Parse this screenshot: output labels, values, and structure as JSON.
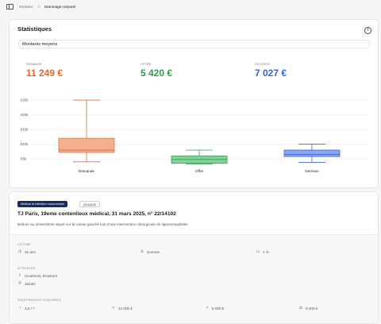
{
  "breadcrumb": {
    "section": "Modules",
    "separator": ">",
    "current": "Dommage corporel"
  },
  "stats": {
    "title": "Statistiques",
    "info_icon": "info-icon",
    "select_value": "Montants moyens",
    "kpis": [
      {
        "label": "DEMANDE",
        "value": "11 249 €",
        "color": "#e0692a"
      },
      {
        "label": "OFFRE",
        "value": "5 420 €",
        "color": "#2e9a4e"
      },
      {
        "label": "DÉCISION",
        "value": "7 027 €",
        "color": "#3563d4"
      }
    ]
  },
  "chart_data": {
    "type": "boxplot",
    "categories": [
      "Demande",
      "Offre",
      "Décision"
    ],
    "y_ticks": [
      {
        "value": 5000,
        "label": "€5k"
      },
      {
        "value": 10000,
        "label": "€10k"
      },
      {
        "value": 15000,
        "label": "€15k"
      },
      {
        "value": 20000,
        "label": "€20k"
      },
      {
        "value": 25000,
        "label": "€25k"
      }
    ],
    "ylim": [
      3000,
      26500
    ],
    "grid": true,
    "boxes": [
      {
        "name": "Demande",
        "min": 4000,
        "q1": 7200,
        "median": 8000,
        "q3": 12000,
        "max": 25000,
        "fill": "#f3b08e",
        "stroke": "#d9733e"
      },
      {
        "name": "Offre",
        "min": 3300,
        "q1": 3500,
        "median": 4800,
        "q3": 6000,
        "max": 8000,
        "fill": "#84d39a",
        "stroke": "#3c9a55"
      },
      {
        "name": "Décision",
        "min": 3800,
        "q1": 5800,
        "median": 6500,
        "q3": 8000,
        "max": 10000,
        "fill": "#86a6ef",
        "stroke": "#3d66cc"
      }
    ]
  },
  "case": {
    "category_badge": "Médical et infection nosocomiale",
    "number_badge": "22/14102",
    "title": "TJ Paris, 19eme contentieux médical, 31 mars 2025, n° 22/14102",
    "description": "Brûlure au 2ème/3ème degré sur la cuisse gauche lors d’une intervention chirurgicale de ligamentoplastie",
    "victim_label": "VICTIME",
    "victim": {
      "age": "31 ans",
      "sex": "Homme",
      "rate": "1 %"
    },
    "attacks_label": "ATTEINTES",
    "attacks": {
      "injuries": "Cicatrices, Douleurs",
      "body": "Jambe"
    },
    "suffering_label": "SOUFFRANCES ENDURÉES",
    "suffering": {
      "score": "3,5 / 7",
      "v1": "14 000 €",
      "v2": "8 000 €",
      "v3": "9 000 €"
    }
  }
}
